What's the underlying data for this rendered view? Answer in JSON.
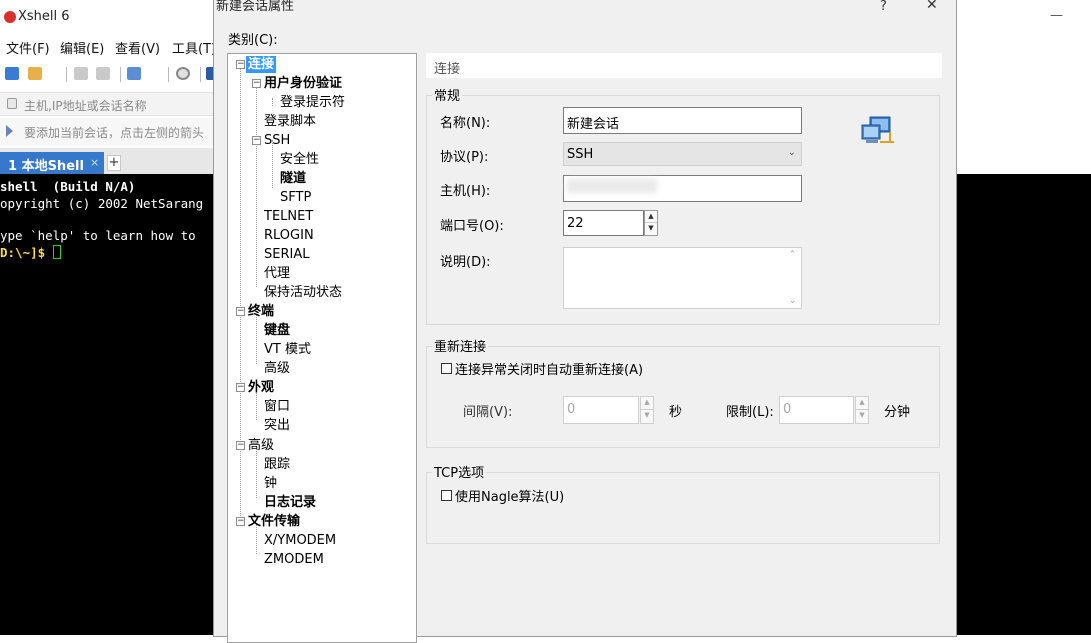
{
  "app": {
    "title": "Xshell 6",
    "minimize_glyph": "—",
    "menu": [
      "文件(F)",
      "编辑(E)",
      "查看(V)",
      "工具(T)"
    ],
    "address_placeholder": "主机,IP地址或会话名称",
    "hint_text": "要添加当前会话，点击左侧的箭头",
    "tab_label": "1 本地Shell",
    "tab_close": "×",
    "tab_add": "+",
    "terminal_lines": [
      "shell  (Build N/A)",
      "opyright (c) 2002 NetSarang",
      "",
      "ype `help' to learn how to",
      "D:\\~]$ "
    ]
  },
  "dialog": {
    "title": "新建会话属性",
    "help_glyph": "?",
    "close_glyph": "✕",
    "category_label": "类别(C):",
    "tree": [
      {
        "label": "连接",
        "bold": true,
        "selected": true
      },
      {
        "label": "用户身份验证",
        "bold": true
      },
      {
        "label": "登录提示符",
        "bold": false
      },
      {
        "label": "登录脚本",
        "bold": false
      },
      {
        "label": "SSH",
        "bold": false
      },
      {
        "label": "安全性",
        "bold": false
      },
      {
        "label": "隧道",
        "bold": true
      },
      {
        "label": "SFTP",
        "bold": false
      },
      {
        "label": "TELNET",
        "bold": false
      },
      {
        "label": "RLOGIN",
        "bold": false
      },
      {
        "label": "SERIAL",
        "bold": false
      },
      {
        "label": "代理",
        "bold": false
      },
      {
        "label": "保持活动状态",
        "bold": false
      },
      {
        "label": "终端",
        "bold": true
      },
      {
        "label": "键盘",
        "bold": true
      },
      {
        "label": "VT 模式",
        "bold": false
      },
      {
        "label": "高级",
        "bold": false
      },
      {
        "label": "外观",
        "bold": true
      },
      {
        "label": "窗口",
        "bold": false
      },
      {
        "label": "突出",
        "bold": false
      },
      {
        "label": "高级",
        "bold": false
      },
      {
        "label": "跟踪",
        "bold": false
      },
      {
        "label": "钟",
        "bold": false
      },
      {
        "label": "日志记录",
        "bold": true
      },
      {
        "label": "文件传输",
        "bold": true
      },
      {
        "label": "X/YMODEM",
        "bold": false
      },
      {
        "label": "ZMODEM",
        "bold": false
      }
    ],
    "panel_header": "连接",
    "general": {
      "legend": "常规",
      "name_label": "名称(N):",
      "name_value": "新建会话",
      "protocol_label": "协议(P):",
      "protocol_value": "SSH",
      "host_label": "主机(H):",
      "host_value": "",
      "port_label": "端口号(O):",
      "port_value": "22",
      "description_label": "说明(D):",
      "description_value": ""
    },
    "reconnect": {
      "legend": "重新连接",
      "auto_reconnect_label": "连接异常关闭时自动重新连接(A)",
      "auto_reconnect_checked": false,
      "interval_label": "间隔(V):",
      "interval_value": "0",
      "interval_unit": "秒",
      "limit_label": "限制(L):",
      "limit_value": "0",
      "limit_unit": "分钟"
    },
    "tcp": {
      "legend": "TCP选项",
      "nagle_label": "使用Nagle算法(U)",
      "nagle_checked": false
    }
  }
}
